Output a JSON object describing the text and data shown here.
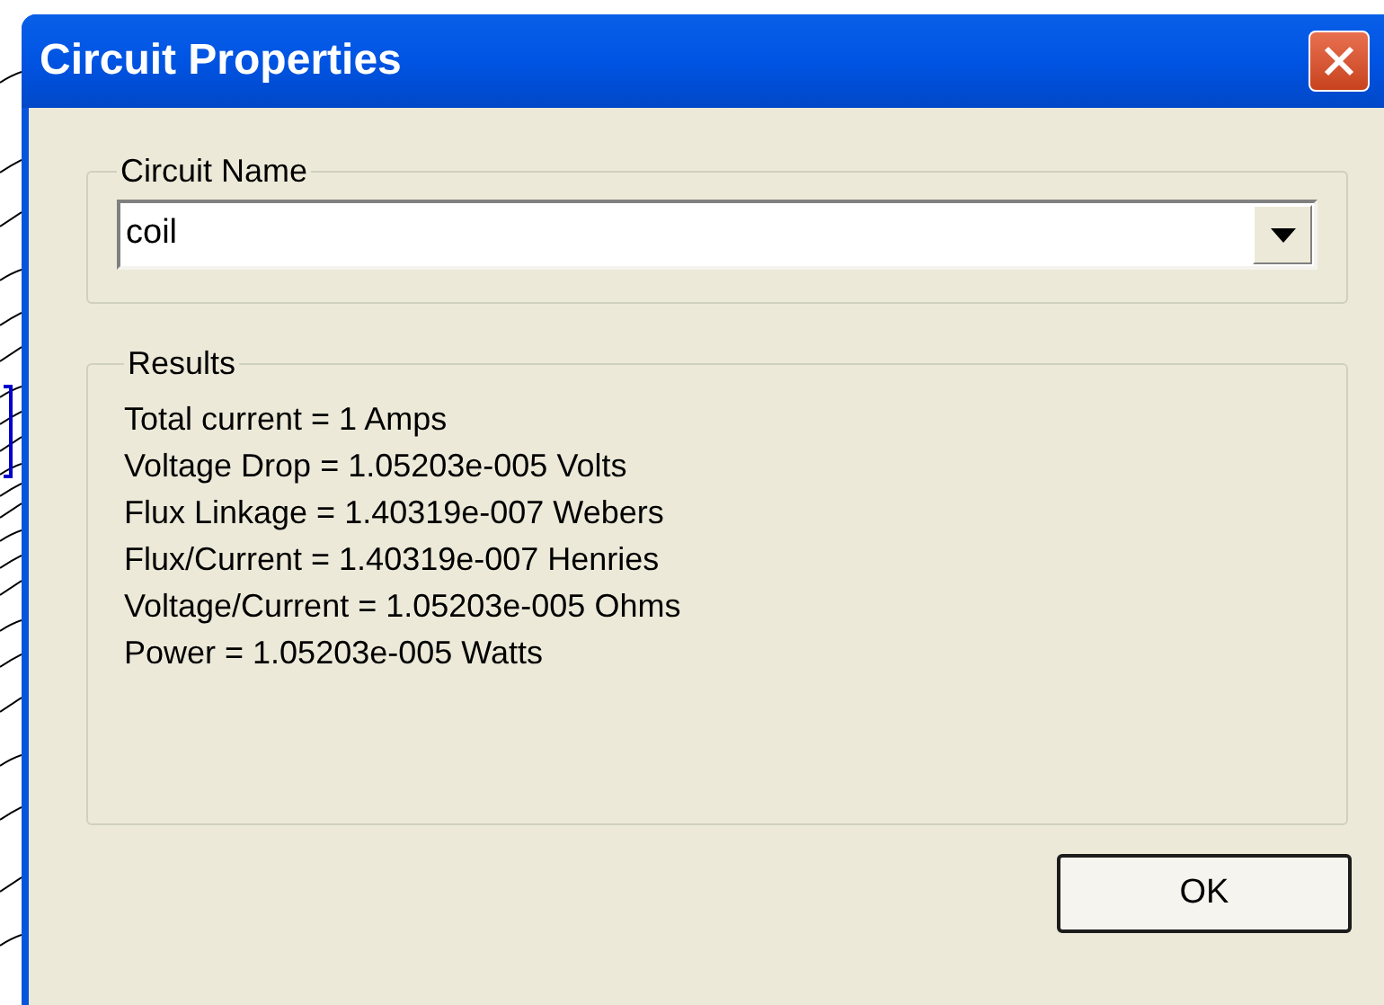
{
  "window": {
    "title": "Circuit Properties"
  },
  "circuit_name": {
    "label": "Circuit Name",
    "value": "coil"
  },
  "results": {
    "label": "Results",
    "lines": [
      "Total current = 1 Amps",
      "Voltage Drop = 1.05203e-005 Volts",
      "Flux Linkage = 1.40319e-007 Webers",
      "Flux/Current = 1.40319e-007 Henries",
      "Voltage/Current = 1.05203e-005 Ohms",
      "Power = 1.05203e-005 Watts"
    ]
  },
  "buttons": [
    "OK"
  ]
}
